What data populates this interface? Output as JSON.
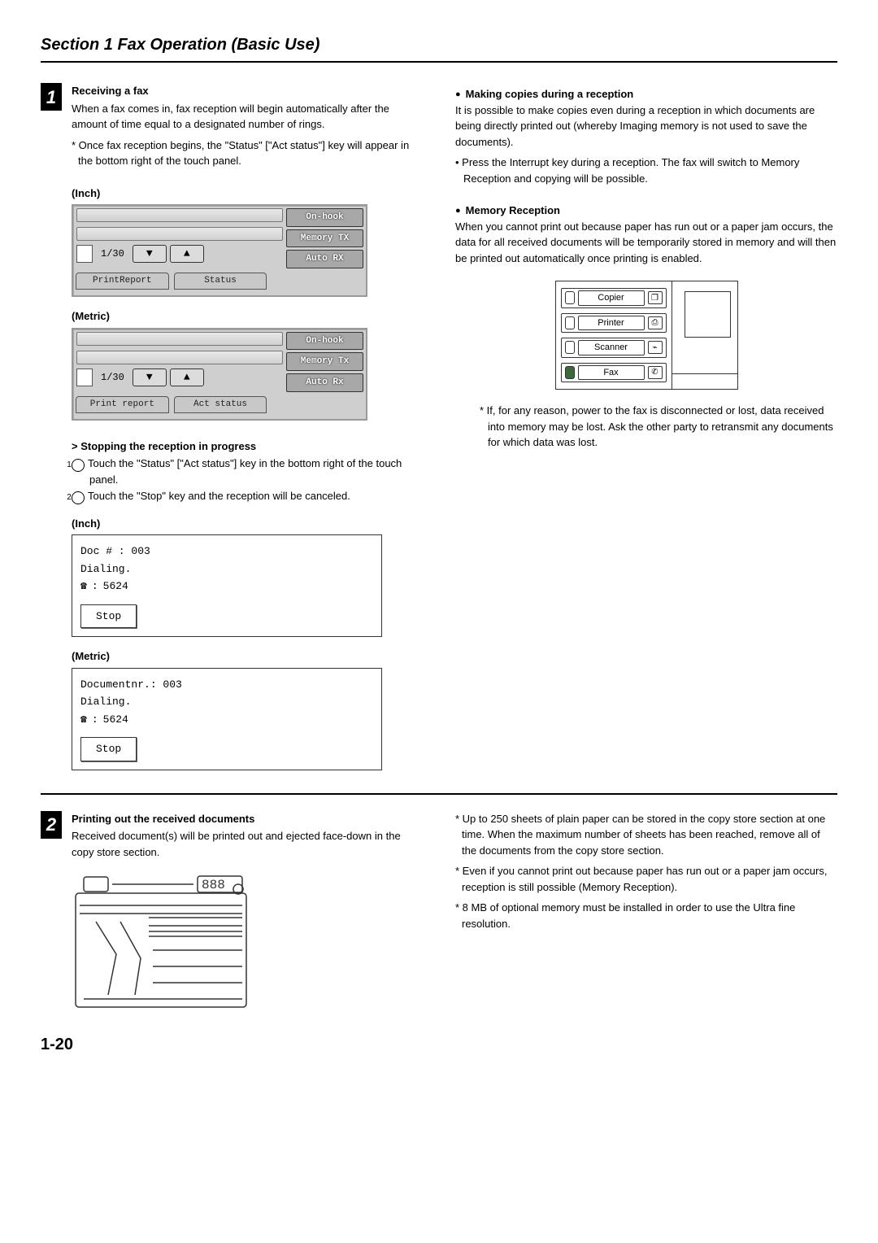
{
  "section_title": "Section 1  Fax Operation (Basic Use)",
  "page_number": "1-20",
  "block1": {
    "num": "1",
    "h1": "Receiving a fax",
    "p1": "When a fax comes in, fax reception will begin automatically after the amount of time equal to a designated number of rings.",
    "note1": "* Once fax reception begins, the \"Status\" [\"Act status\"] key will appear in the bottom right of the touch panel.",
    "label_inch": "(Inch)",
    "label_metric": "(Metric)",
    "panel_inch": {
      "count": "1/30",
      "btn1": "On-hook",
      "btn2": "Memory TX",
      "btn3": "Auto RX",
      "tab1": "PrintReport",
      "tab2": "Status"
    },
    "panel_metric": {
      "count": "1/30",
      "btn1": "On-hook",
      "btn2": "Memory Tx",
      "btn3": "Auto Rx",
      "tab1": "Print report",
      "tab2": "Act status"
    },
    "h2": "> Stopping the reception in progress",
    "step1": "Touch the \"Status\" [\"Act status\"] key in the bottom right of the touch panel.",
    "step2": "Touch the \"Stop\" key and the reception will be canceled.",
    "stop_inch": {
      "l1": "Doc #   : 003",
      "l2": "Dialing.",
      "l3": "5624",
      "btn": "Stop"
    },
    "stop_metric": {
      "l1": "Documentnr.: 003",
      "l2": "Dialing.",
      "l3": "5624",
      "btn": "Stop"
    }
  },
  "right": {
    "h1": "Making copies during a reception",
    "p1": "It is possible to make copies even during a reception in which documents are being directly printed out (whereby Imaging memory is not used to save the documents).",
    "b1": "• Press the Interrupt key during a reception. The fax will switch to Memory Reception and copying will be possible.",
    "h2": "Memory Reception",
    "p2": "When you cannot print out because paper has run out or a paper jam occurs, the data for all received documents will be temporarily stored in memory and will then be printed out automatically once printing is enabled.",
    "device": {
      "copier": "Copier",
      "printer": "Printer",
      "scanner": "Scanner",
      "fax": "Fax"
    },
    "star": "* If, for any reason, power to the fax is disconnected or lost, data received into memory may be lost. Ask the other party to retransmit any documents for which data was lost."
  },
  "block2": {
    "num": "2",
    "h1": "Printing out the received documents",
    "p1": "Received document(s) will be printed out and ejected face-down in the copy store section.",
    "counter": "888"
  },
  "right2": {
    "n1": "* Up to 250 sheets of plain paper can be stored in the copy store section at one time. When the maximum number of sheets has been reached, remove all of the documents from the copy store section.",
    "n2": "* Even if you cannot print out because paper has run out or a paper jam occurs, reception is still possible (Memory Reception).",
    "n3": "* 8 MB of optional memory must be installed in order to use the Ultra fine resolution."
  }
}
